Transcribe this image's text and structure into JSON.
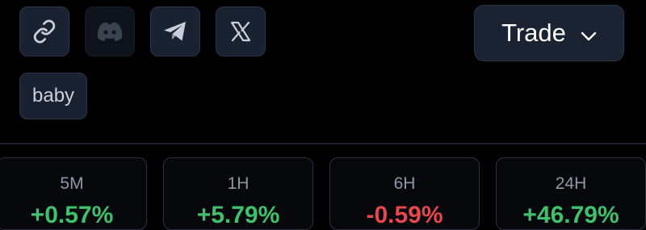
{
  "social_links": [
    {
      "icon": "link-icon"
    },
    {
      "icon": "discord-icon"
    },
    {
      "icon": "telegram-icon"
    },
    {
      "icon": "x-icon"
    }
  ],
  "trade": {
    "label": "Trade",
    "icon": "chevron-down-icon"
  },
  "tag": {
    "label": "baby"
  },
  "stats": [
    {
      "label": "5M",
      "value": "+0.57%",
      "color": "#3fc06a"
    },
    {
      "label": "1H",
      "value": "+5.79%",
      "color": "#3fc06a"
    },
    {
      "label": "6H",
      "value": "-0.59%",
      "color": "#e5484d"
    },
    {
      "label": "24H",
      "value": "+46.79%",
      "color": "#3fc06a"
    }
  ],
  "colors": {
    "background": "#000000",
    "button_bg": "#1a2130",
    "positive": "#3fc06a",
    "negative": "#e5484d"
  }
}
